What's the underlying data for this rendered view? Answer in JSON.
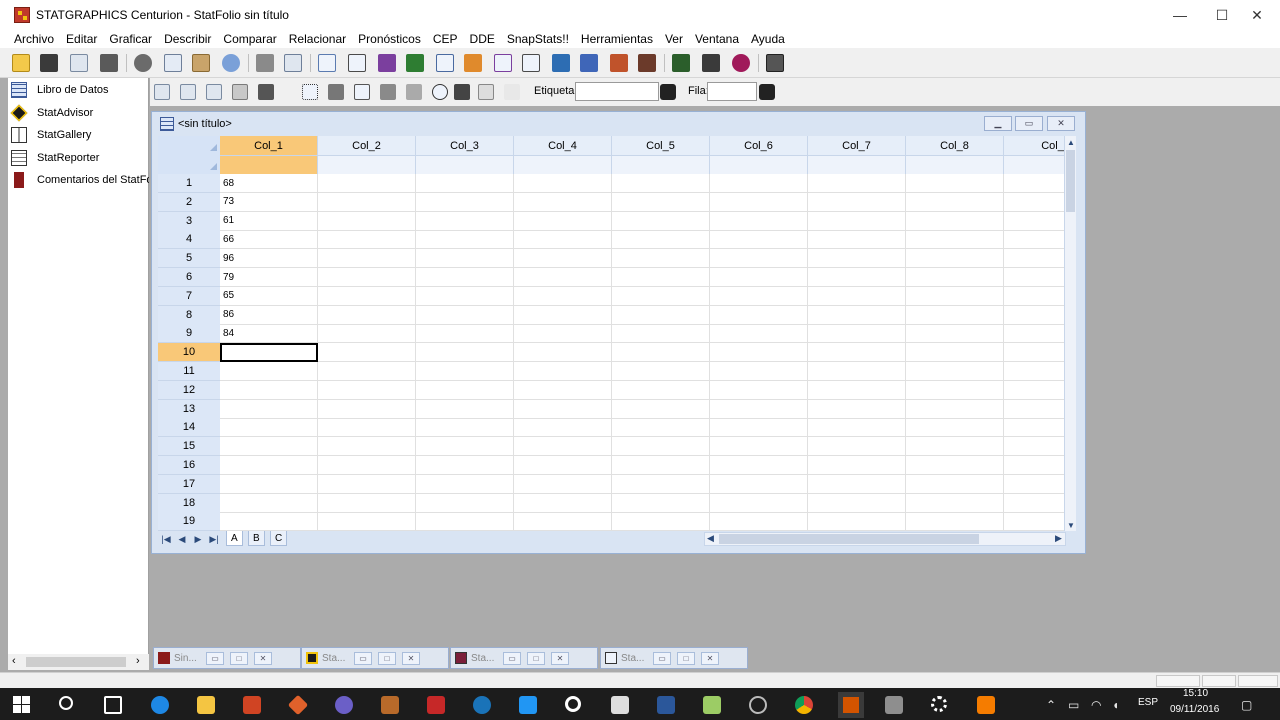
{
  "window": {
    "title": "STATGRAPHICS Centurion - StatFolio sin título",
    "minimize": "—",
    "maximize": "☐",
    "close": "✕"
  },
  "menu": [
    "Archivo",
    "Editar",
    "Graficar",
    "Describir",
    "Comparar",
    "Relacionar",
    "Pronósticos",
    "CEP",
    "DDE",
    "SnapStats!!",
    "Herramientas",
    "Ver",
    "Ventana",
    "Ayuda"
  ],
  "sidebar": {
    "items": [
      "Libro de Datos",
      "StatAdvisor",
      "StatGallery",
      "StatReporter",
      "Comentarios del StatFolio"
    ],
    "scroll_left": "‹",
    "scroll_right": "›"
  },
  "toolbar2": {
    "etiqueta_label": "Etiqueta:",
    "etiqueta_value": "",
    "fila_label": "Fila:",
    "fila_value": ""
  },
  "datasheet": {
    "title": "<sin título>",
    "columns": [
      "Col_1",
      "Col_2",
      "Col_3",
      "Col_4",
      "Col_5",
      "Col_6",
      "Col_7",
      "Col_8",
      "Col_"
    ],
    "rows": [
      "1",
      "2",
      "3",
      "4",
      "5",
      "6",
      "7",
      "8",
      "9",
      "10",
      "11",
      "12",
      "13",
      "14",
      "15",
      "16",
      "17",
      "18",
      "19"
    ],
    "col1_values": [
      "68",
      "73",
      "61",
      "66",
      "96",
      "79",
      "65",
      "86",
      "84"
    ],
    "selected_row": 10,
    "sheet_tabs": [
      "A",
      "B",
      "C"
    ]
  },
  "minimized_windows": [
    {
      "label": "Sin...",
      "icon": "comments-icon"
    },
    {
      "label": "Sta...",
      "icon": "statadvisor-icon"
    },
    {
      "label": "Sta...",
      "icon": "statgallery-icon"
    },
    {
      "label": "Sta...",
      "icon": "statreporter-icon"
    }
  ],
  "taskbar": {
    "lang": "ESP",
    "time": "15:10",
    "date": "09/11/2016"
  },
  "colors": {
    "selection": "#f9c878",
    "grid_header": "#e6eef9",
    "window_frame": "#d9e4f3",
    "taskbar": "#1c1c1c"
  }
}
